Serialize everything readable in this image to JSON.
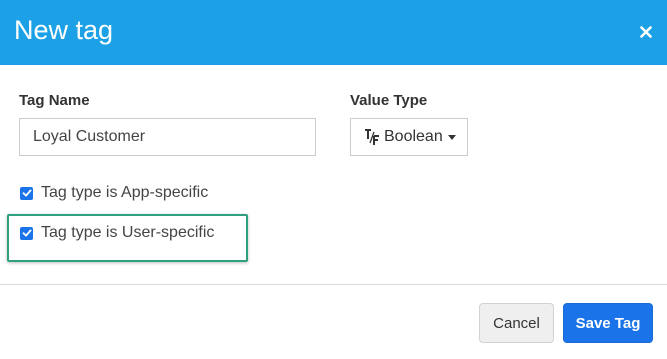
{
  "dialog": {
    "title": "New tag",
    "close_icon": "close-icon"
  },
  "form": {
    "tag_name_label": "Tag Name",
    "tag_name_value": "Loyal Customer",
    "value_type_label": "Value Type",
    "value_type_icon": "true-false-icon",
    "value_type_selected": "Boolean",
    "checkboxes": [
      {
        "label": "Tag type is App-specific",
        "checked": true
      },
      {
        "label": "Tag type is User-specific",
        "checked": true
      }
    ]
  },
  "footer": {
    "cancel_label": "Cancel",
    "save_label": "Save Tag"
  },
  "colors": {
    "header": "#1da1e6",
    "primary": "#1a73e8",
    "highlight": "#2e9f7f"
  }
}
